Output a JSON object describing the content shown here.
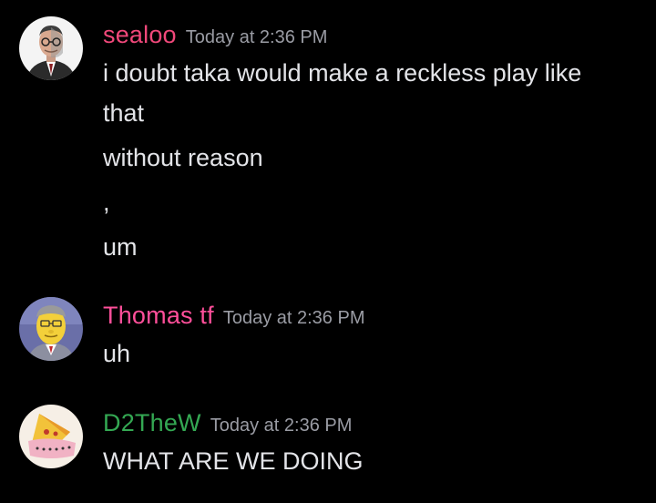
{
  "messages": [
    {
      "author": "sealoo",
      "author_color": "#f0487a",
      "timestamp": "Today at 2:36 PM",
      "avatar_icon": "man-with-glasses-avatar",
      "lines": [
        "i doubt taka would make a reckless play like",
        "that",
        "without reason",
        ",",
        "um"
      ]
    },
    {
      "author": "Thomas tf",
      "author_color": "#ff4f9a",
      "timestamp": "Today at 2:36 PM",
      "avatar_icon": "cartoon-character-avatar",
      "lines": [
        "uh"
      ]
    },
    {
      "author": "D2TheW",
      "author_color": "#34a853",
      "timestamp": "Today at 2:36 PM",
      "avatar_icon": "cartoon-pizza-avatar",
      "lines": [
        "WHAT ARE WE DOING"
      ]
    }
  ]
}
